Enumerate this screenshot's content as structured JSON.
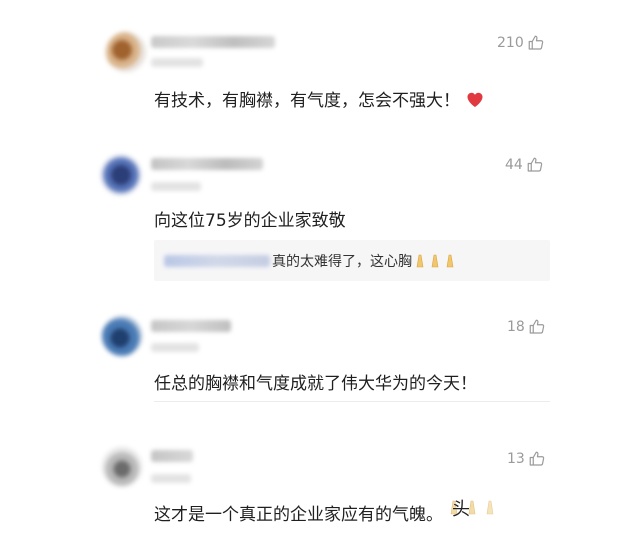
{
  "comments": [
    {
      "likes": "210",
      "text": "有技术，有胸襟，有气度，怎会不强大！",
      "emoji": "heart-icon"
    },
    {
      "likes": "44",
      "text": "向这位75岁的企业家致敬",
      "reply": {
        "text": "真的太难得了，这心胸"
      }
    },
    {
      "likes": "18",
      "text": "任总的胸襟和气度成就了伟大华为的今天！"
    },
    {
      "likes": "13",
      "text": "这才是一个真正的企业家应有的气魄。"
    }
  ],
  "watermark": {
    "text": "头"
  },
  "colors": {
    "like_count": "#9a9a9a",
    "reply_background": "#f6f6f7",
    "heart": "#e0393f"
  }
}
